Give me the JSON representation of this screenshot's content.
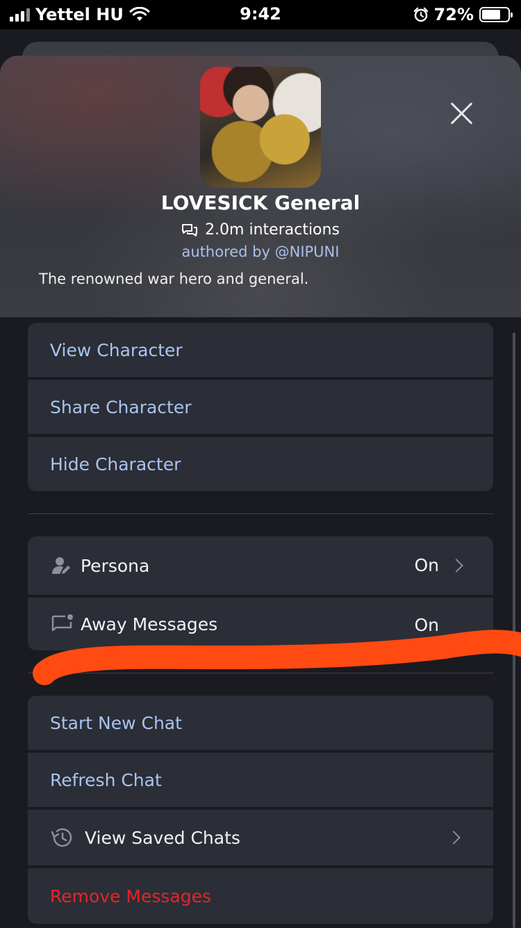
{
  "status_bar": {
    "carrier": "Yettel HU",
    "time": "9:42",
    "battery": "72%",
    "battery_level": 0.72
  },
  "character": {
    "name": "LOVESICK General",
    "interactions": "2.0m interactions",
    "author": "authored by @NIPUNI",
    "description": "The renowned war hero and general."
  },
  "menu": {
    "group1": [
      "View Character",
      "Share Character",
      "Hide Character"
    ],
    "persona": {
      "label": "Persona",
      "value": "On"
    },
    "away": {
      "label": "Away Messages",
      "value": "On"
    },
    "group3": {
      "start_new_chat": "Start New Chat",
      "refresh_chat": "Refresh Chat",
      "view_saved_chats": "View Saved Chats",
      "remove_messages": "Remove Messages"
    }
  },
  "colors": {
    "accent_text": "#a8c4f0",
    "danger": "#e5252a",
    "annotation": "#ff4a12"
  }
}
